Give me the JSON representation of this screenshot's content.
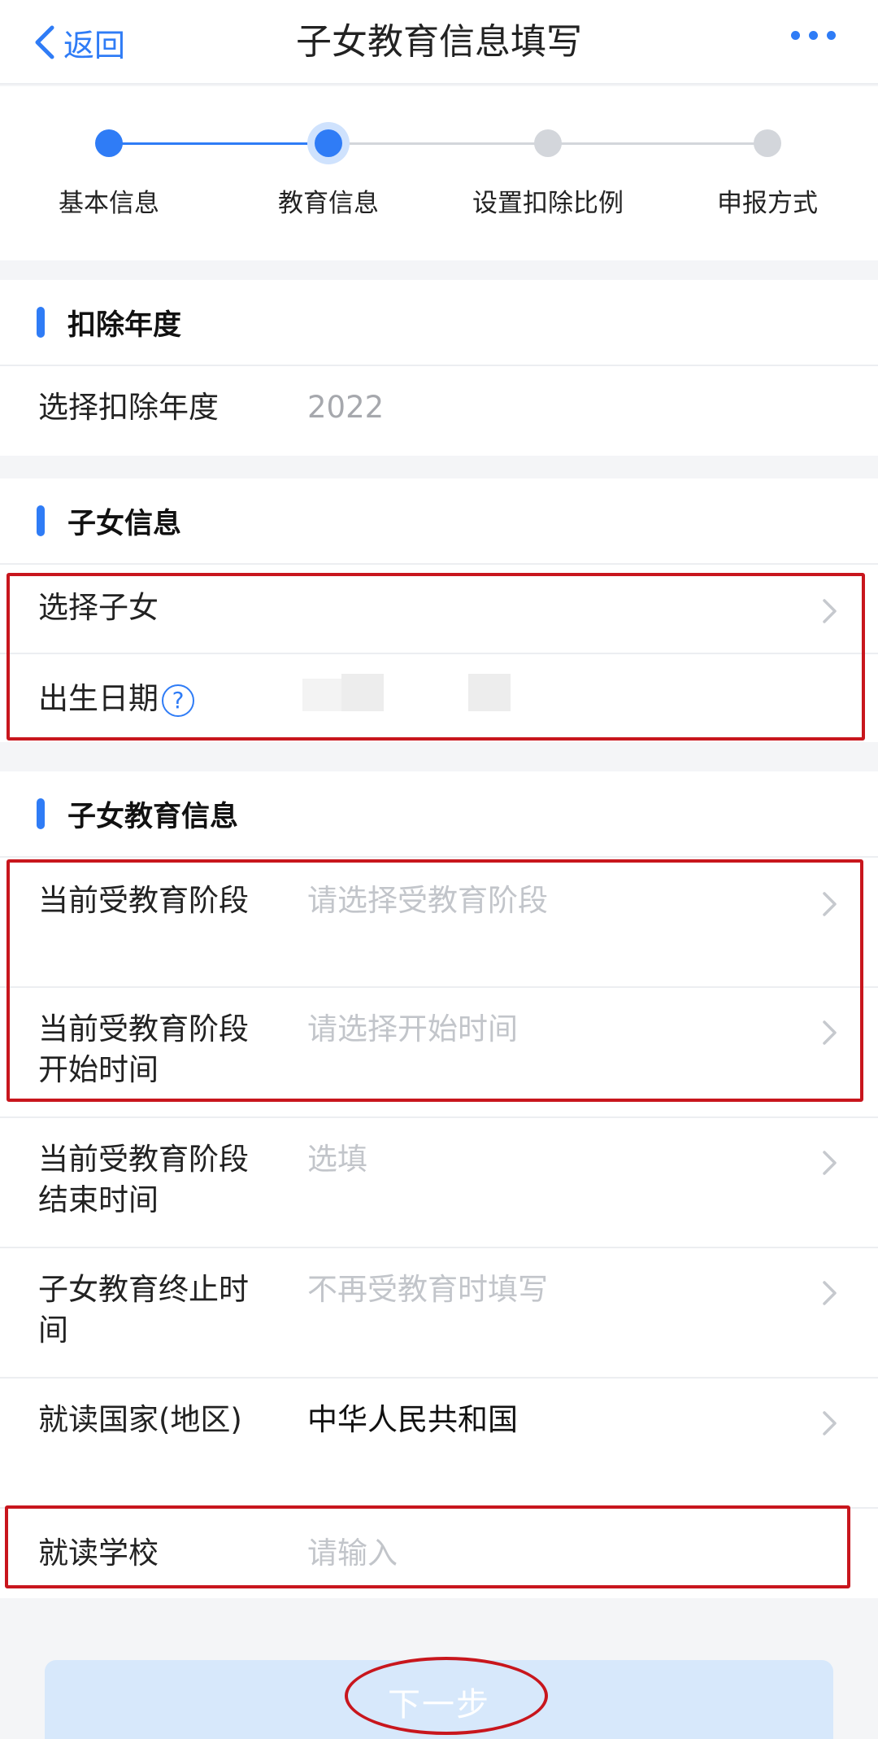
{
  "nav": {
    "back_label": "返回",
    "title": "子女教育信息填写"
  },
  "steps": [
    {
      "label": "基本信息",
      "state": "done"
    },
    {
      "label": "教育信息",
      "state": "current"
    },
    {
      "label": "设置扣除比例",
      "state": "todo"
    },
    {
      "label": "申报方式",
      "state": "todo"
    }
  ],
  "deduction_year": {
    "heading": "扣除年度",
    "label": "选择扣除年度",
    "value": "2022"
  },
  "child_info": {
    "heading": "子女信息",
    "select_child_label": "选择子女",
    "birth_date_label": "出生日期",
    "help_glyph": "?"
  },
  "education_info": {
    "heading": "子女教育信息",
    "rows": [
      {
        "label": "当前受教育阶段",
        "value": "请选择受教育阶段",
        "style": "placeholder"
      },
      {
        "label": "当前受教育阶段开始时间",
        "value": "请选择开始时间",
        "style": "placeholder"
      },
      {
        "label": "当前受教育阶段结束时间",
        "value": "选填",
        "style": "placeholder"
      },
      {
        "label": "子女教育终止时间",
        "value": "不再受教育时填写",
        "style": "placeholder"
      },
      {
        "label": "就读国家(地区)",
        "value": "中华人民共和国",
        "style": "value"
      },
      {
        "label": "就读学校",
        "value": "请输入",
        "style": "placeholder"
      }
    ]
  },
  "next_button_label": "下一步",
  "colors": {
    "accent": "#2f7cf6",
    "annotation_red": "#c8161d",
    "button_bg": "#d7e8fb"
  },
  "icons": [
    "chevron-left-icon",
    "more-dots-icon",
    "chevron-right-icon",
    "help-circle-icon"
  ]
}
